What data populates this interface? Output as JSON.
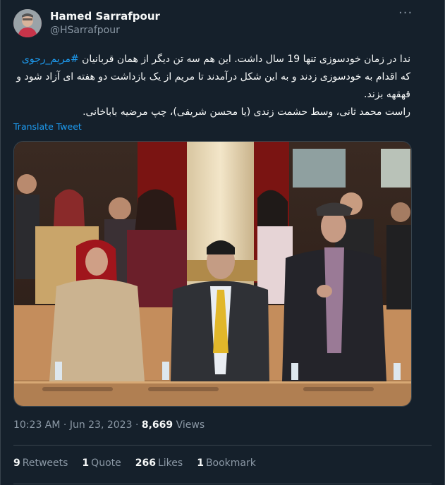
{
  "author": {
    "name": "Hamed Sarrafpour",
    "handle": "@HSarrafpour"
  },
  "tweet": {
    "line1_pre": "ندا در زمان خودسوزی تنها 19 سال داشت. این هم سه تن دیگر از همان قربانیان ",
    "hashtag": "#مریم_رجوی",
    "line1_post": " که اقدام به خودسوزی زدند و به این شکل درآمدند تا مریم از یک بازداشت دو هفته ای آزاد شود و قهقهه بزند.",
    "line2": "راست محمد ثانی، وسط حشمت زندی (یا محسن شریفی)، چپ مرضیه باباخانی.",
    "translate_label": "Translate Tweet"
  },
  "meta": {
    "time": "10:23 AM",
    "separator": "·",
    "date": "Jun 23, 2023",
    "views_count": "8,669",
    "views_label": "Views"
  },
  "stats": {
    "retweets_count": "9",
    "retweets_label": "Retweets",
    "quotes_count": "1",
    "quotes_label": "Quote",
    "likes_count": "266",
    "likes_label": "Likes",
    "bookmarks_count": "1",
    "bookmarks_label": "Bookmark"
  },
  "icons": {
    "more": "more-options-icon"
  },
  "colors": {
    "background": "#15202b",
    "accent": "#1d9bf0",
    "muted": "#8b98a5",
    "border": "#38444d"
  }
}
